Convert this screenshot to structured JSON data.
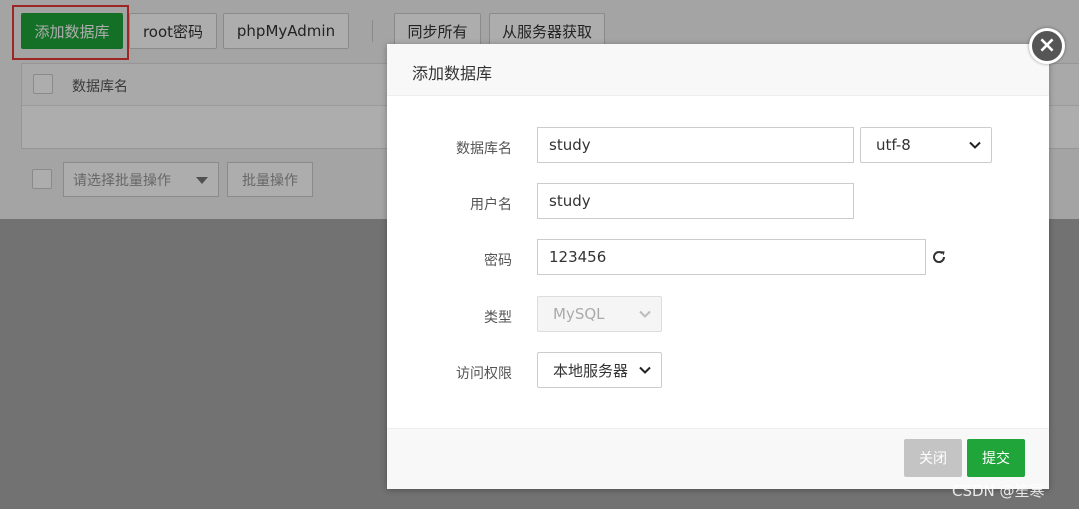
{
  "toolbar": {
    "add_db": "添加数据库",
    "root_password": "root密码",
    "phpmyadmin": "phpMyAdmin",
    "sync_all": "同步所有",
    "fetch_from_server": "从服务器获取"
  },
  "table": {
    "col_db_name": "数据库名"
  },
  "batch": {
    "select_placeholder": "请选择批量操作",
    "batch_button": "批量操作"
  },
  "dialog": {
    "title": "添加数据库",
    "fields": {
      "db_name_label": "数据库名",
      "db_name_value": "study",
      "charset_value": "utf-8",
      "username_label": "用户名",
      "username_value": "study",
      "password_label": "密码",
      "password_value": "123456",
      "type_label": "类型",
      "type_value": "MySQL",
      "access_label": "访问权限",
      "access_value": "本地服务器"
    },
    "close_label": "关闭",
    "submit_label": "提交"
  },
  "watermark": "CSDN @笙寒",
  "colors": {
    "primary_green": "#20a53a",
    "highlight_red": "#e53935"
  }
}
